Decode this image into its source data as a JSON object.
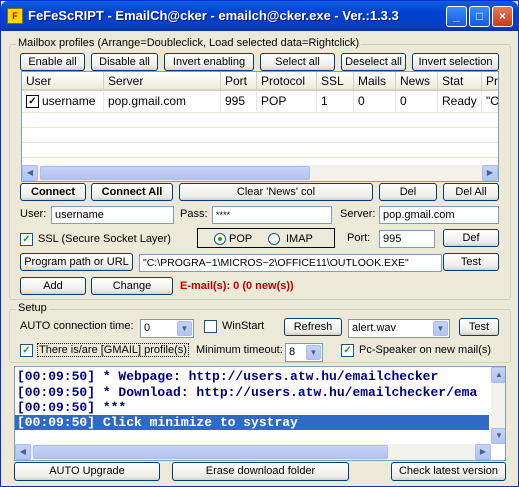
{
  "window": {
    "title": "FeFeScRIPT - EmailCh@cker - emailch@cker.exe - Ver.:1.3.3",
    "app_icon": "app-icon"
  },
  "profiles": {
    "legend": "Mailbox profiles (Arrange=Doubleclick, Load selected data=Rightclick)",
    "buttons": {
      "enable_all": "Enable all",
      "disable_all": "Disable all",
      "invert_enabling": "Invert enabling",
      "select_all": "Select all",
      "deselect_all": "Deselect all",
      "invert_selection": "Invert selection"
    },
    "columns": [
      "User",
      "Server",
      "Port",
      "Protocol",
      "SSL",
      "Mails",
      "News",
      "Stat",
      "Prog"
    ],
    "rows": [
      {
        "checked": true,
        "cells": [
          "username",
          "pop.gmail.com",
          "995",
          "POP",
          "1",
          "0",
          "0",
          "Ready",
          "\"C:\\P"
        ]
      }
    ],
    "actions": {
      "connect": "Connect",
      "connect_all": "Connect All",
      "clear_news": "Clear 'News' col",
      "del": "Del",
      "del_all": "Del All"
    },
    "user_label": "User:",
    "user_value": "username",
    "pass_label": "Pass:",
    "pass_value": "****",
    "server_label": "Server:",
    "server_value": "pop.gmail.com",
    "ssl_label": "SSL (Secure Socket Layer)",
    "ssl_checked": true,
    "protocol_pop": "POP",
    "protocol_imap": "IMAP",
    "protocol_selected": "POP",
    "port_label": "Port:",
    "port_value": "995",
    "def_button": "Def",
    "program_button": "Program path or URL",
    "program_value": "\"C:\\PROGRA~1\\MICROS~2\\OFFICE11\\OUTLOOK.EXE\"",
    "test_button": "Test",
    "add_button": "Add",
    "change_button": "Change",
    "email_status": "E-mail(s): 0 (0 new(s))",
    "email_status_color": "#c00000"
  },
  "setup": {
    "legend": "Setup",
    "auto_conn_label": "AUTO connection time:",
    "auto_conn_value": "0",
    "winstart_label": "WinStart",
    "winstart_checked": false,
    "refresh_button": "Refresh",
    "sound_value": "alert.wav",
    "test_button": "Test",
    "gmail_label": "There is/are [GMAIL] profile(s)",
    "gmail_checked": true,
    "min_timeout_label": "Minimum timeout:",
    "min_timeout_value": "8",
    "pc_speaker_label": "Pc-Speaker on new mail(s)",
    "pc_speaker_checked": true
  },
  "log": {
    "lines": [
      "[00:09:50] * Webpage: http://users.atw.hu/emailchecker",
      "[00:09:50] * Download: http://users.atw.hu/emailchecker/ema",
      "[00:09:50] ***",
      "[00:09:50] Click minimize to systray"
    ],
    "selected_index": 3
  },
  "footer": {
    "auto_upgrade": "AUTO Upgrade",
    "erase_folder": "Erase download folder",
    "check_version": "Check latest version"
  }
}
